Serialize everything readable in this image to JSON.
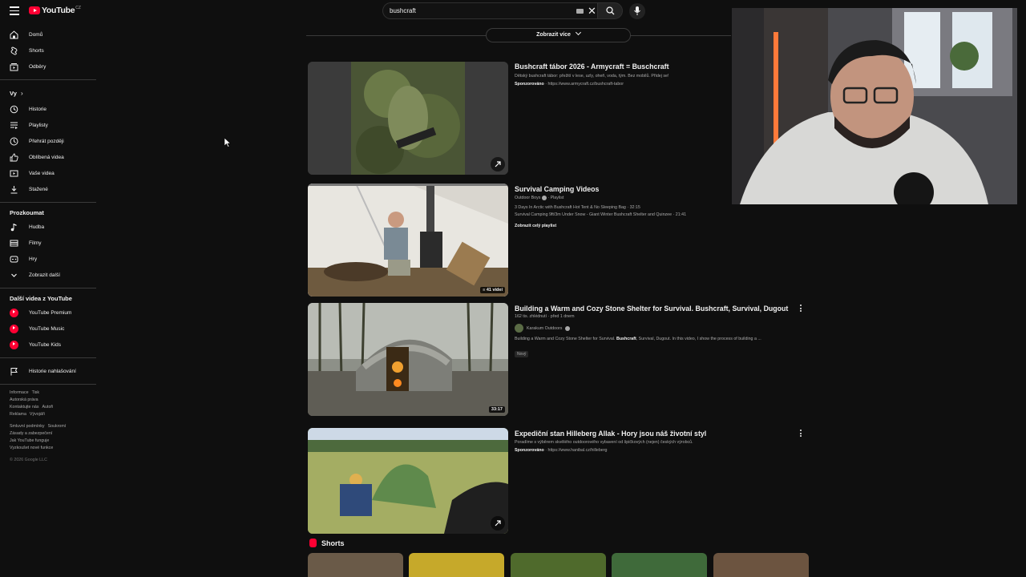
{
  "header": {
    "logo_text": "YouTube",
    "country_code": "CZ",
    "search_value": "bushcraft"
  },
  "sidebar": {
    "main": [
      {
        "label": "Domů",
        "icon": "home-icon"
      },
      {
        "label": "Shorts",
        "icon": "shorts-icon"
      },
      {
        "label": "Odběry",
        "icon": "subscriptions-icon"
      }
    ],
    "you_title": "Vy",
    "you": [
      {
        "label": "Historie",
        "icon": "history-icon"
      },
      {
        "label": "Playlisty",
        "icon": "playlists-icon"
      },
      {
        "label": "Přehrát později",
        "icon": "clock-icon"
      },
      {
        "label": "Oblíbená videa",
        "icon": "thumbs-up-icon"
      },
      {
        "label": "Vaše videa",
        "icon": "video-icon"
      },
      {
        "label": "Stažené",
        "icon": "download-icon"
      }
    ],
    "explore_title": "Prozkoumat",
    "explore": [
      {
        "label": "Hudba",
        "icon": "music-icon"
      },
      {
        "label": "Filmy",
        "icon": "film-icon"
      },
      {
        "label": "Hry",
        "icon": "gamepad-icon"
      },
      {
        "label": "Zobrazit další",
        "icon": "chevron-down-icon"
      }
    ],
    "more_title": "Další videa z YouTube",
    "more": [
      {
        "label": "YouTube Premium",
        "icon": "youtube-premium-icon"
      },
      {
        "label": "YouTube Music",
        "icon": "youtube-music-icon"
      },
      {
        "label": "YouTube Kids",
        "icon": "youtube-kids-icon"
      }
    ],
    "report": {
      "label": "Historie nahlašování",
      "icon": "flag-icon"
    },
    "footer": {
      "line1": [
        "Informace",
        "Tisk"
      ],
      "line2": [
        "Autorská práva"
      ],
      "line3": [
        "Kontaktujte nás",
        "Autoři"
      ],
      "line4": [
        "Reklama",
        "Vývojáři"
      ],
      "line5": [
        "Smluvní podmínky",
        "Soukromí"
      ],
      "line6": [
        "Zásady a zabezpečení"
      ],
      "line7": [
        "Jak YouTube funguje"
      ],
      "line8": [
        "Vyzkoušet nové funkce"
      ],
      "copyright": "© 2026 Google LLC"
    }
  },
  "main": {
    "show_more_label": "Zobrazit více",
    "results": [
      {
        "title": "Bushcraft tábor 2026 - Armycraft = Buschcraft",
        "desc": "Dětský bushcraft tábor: přežití v lese, uzly, oheň, voda, tým. Bez mobilů. Přidej se!",
        "sponsored": "Sponzorováno",
        "url": "https://www.armycraft.cz/bushcraft-tabor"
      },
      {
        "title": "Survival Camping Videos",
        "channel": "Outdoor Boys",
        "kind": "Playlist",
        "item1": "3 Days In Arctic with Bushcraft Hot Tent & No Sleeping Bag · 32:15",
        "item2": "Survival Camping 9ft/3m Under Snow - Giant Winter Bushcraft Shelter and Quinzee · 21:41",
        "view_all": "Zobrazit celý playlist",
        "count_badge": "41 videí"
      },
      {
        "title": "Building a Warm and Cozy Stone Shelter for Survival. Bushcraft, Survival, Dugout",
        "meta": "162 tis. zhlédnutí · před 1 dnem",
        "channel": "Karakum Outdoors",
        "desc_pre": "Building a Warm and Cozy Stone Shelter for Survival. ",
        "desc_bold": "Bushcraft",
        "desc_post": ", Survival, Dugout. In this video, I show the process of building a ...",
        "badge": "Nový",
        "duration": "33:17"
      },
      {
        "title": "Expediční stan Hilleberg Allak - Hory jsou náš životní styl",
        "desc": "Poradíme s výběrem skvělého outdoorového vybavení od špičkových (nejen) českých výrobců.",
        "sponsored": "Sponzorováno",
        "url": "https://www.hanibal.cz/hilleberg"
      }
    ],
    "shorts_title": "Shorts"
  },
  "colors": {
    "background": "#0f0f0f",
    "brand_red": "#ff0033",
    "text_primary": "#f1f1f1",
    "text_secondary": "#aaaaaa"
  }
}
